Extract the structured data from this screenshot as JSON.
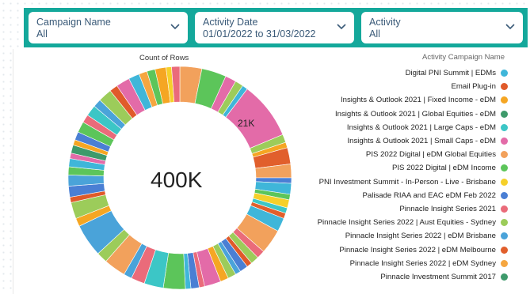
{
  "filters": [
    {
      "label": "Campaign Name",
      "value": "All"
    },
    {
      "label": "Activity Date",
      "value": "01/01/2022 to 31/03/2022"
    },
    {
      "label": "Activity",
      "value": "All"
    }
  ],
  "chart": {
    "title": "Count of Rows",
    "center_label": "400K",
    "slice_label": "21K"
  },
  "legend": {
    "title": "Activity Campaign Name",
    "items": [
      {
        "name": "Digital PNI Summit | EDMs",
        "color": "#3fb6d9"
      },
      {
        "name": "Email Plug-in",
        "color": "#e05a2a"
      },
      {
        "name": "Insights & Outlook 2021 | Fixed Income - eDM",
        "color": "#f5a623"
      },
      {
        "name": "Insights & Outlook 2021 | Global Equities - eDM",
        "color": "#3e9a6b"
      },
      {
        "name": "Insights & Outlook 2021 | Large Caps - eDM",
        "color": "#3cc6c6"
      },
      {
        "name": "Insights & Outlook 2021 | Small Caps - eDM",
        "color": "#e36ba8"
      },
      {
        "name": "PIS 2022 Digital | eDM Global Equities",
        "color": "#f2a15c"
      },
      {
        "name": "PIS 2022 Digital | eDM Income",
        "color": "#5cc55a"
      },
      {
        "name": "PNI Investment Summit - In-Person - Live - Brisbane",
        "color": "#f5d02a"
      },
      {
        "name": "Palisade RIAA and EAC eDM Feb 2022",
        "color": "#4a7fd4"
      },
      {
        "name": "Pinnacle Insight Series 2021",
        "color": "#ea6b7a"
      },
      {
        "name": "Pinnacle Insight Series 2022 | Aust Equities - Sydney",
        "color": "#9ccc5a"
      },
      {
        "name": "Pinnacle Insight Series 2022 | eDM Brisbane",
        "color": "#4aa3d9"
      },
      {
        "name": "Pinnacle Insight Series 2022 | eDM Melbourne",
        "color": "#e15f2c"
      },
      {
        "name": "Pinnacle Insight Series 2022 | eDM Sydney",
        "color": "#f5a640"
      },
      {
        "name": "Pinnacle Investment Summit 2017",
        "color": "#3e9a6b"
      }
    ]
  },
  "chart_data": {
    "type": "pie",
    "title": "Count of Rows",
    "total": 400000,
    "annotations": [
      "400K",
      "21K"
    ],
    "legend_title": "Activity Campaign Name",
    "legend_placement": "right",
    "series": [
      "Digital PNI Summit | EDMs",
      "Email Plug-in",
      "Insights & Outlook 2021 | Fixed Income - eDM",
      "Insights & Outlook 2021 | Global Equities - eDM",
      "Insights & Outlook 2021 | Large Caps - eDM",
      "Insights & Outlook 2021 | Small Caps - eDM",
      "PIS 2022 Digital | eDM Global Equities",
      "PIS 2022 Digital | eDM Income",
      "PNI Investment Summit - In-Person - Live - Brisbane",
      "Palisade RIAA and EAC eDM Feb 2022",
      "Pinnacle Insight Series 2021",
      "Pinnacle Insight Series 2022 | Aust Equities - Sydney",
      "Pinnacle Insight Series 2022 | eDM Brisbane",
      "Pinnacle Insight Series 2022 | eDM Melbourne",
      "Pinnacle Insight Series 2022 | eDM Sydney",
      "Pinnacle Investment Summit 2017"
    ],
    "slices": [
      {
        "ci": 6,
        "v": 8
      },
      {
        "ci": 7,
        "v": 9
      },
      {
        "ci": 5,
        "v": 4
      },
      {
        "ci": 11,
        "v": 3
      },
      {
        "ci": 0,
        "v": 2
      },
      {
        "ci": 5,
        "v": 21
      },
      {
        "ci": 11,
        "v": 3
      },
      {
        "ci": 2,
        "v": 2
      },
      {
        "ci": 13,
        "v": 6
      },
      {
        "ci": 6,
        "v": 5
      },
      {
        "ci": 9,
        "v": 2
      },
      {
        "ci": 0,
        "v": 4
      },
      {
        "ci": 7,
        "v": 2
      },
      {
        "ci": 8,
        "v": 3
      },
      {
        "ci": 4,
        "v": 2
      },
      {
        "ci": 13,
        "v": 2
      },
      {
        "ci": 0,
        "v": 5
      },
      {
        "ci": 6,
        "v": 9
      },
      {
        "ci": 10,
        "v": 3
      },
      {
        "ci": 11,
        "v": 3
      },
      {
        "ci": 1,
        "v": 2
      },
      {
        "ci": 9,
        "v": 3
      },
      {
        "ci": 12,
        "v": 2
      },
      {
        "ci": 11,
        "v": 3
      },
      {
        "ci": 2,
        "v": 3
      },
      {
        "ci": 5,
        "v": 6
      },
      {
        "ci": 10,
        "v": 2
      },
      {
        "ci": 9,
        "v": 3
      },
      {
        "ci": 0,
        "v": 2
      },
      {
        "ci": 7,
        "v": 8
      },
      {
        "ci": 4,
        "v": 7
      },
      {
        "ci": 10,
        "v": 5
      },
      {
        "ci": 12,
        "v": 3
      },
      {
        "ci": 6,
        "v": 8
      },
      {
        "ci": 11,
        "v": 4
      },
      {
        "ci": 12,
        "v": 12
      },
      {
        "ci": 2,
        "v": 3
      },
      {
        "ci": 11,
        "v": 6
      },
      {
        "ci": 1,
        "v": 2
      },
      {
        "ci": 9,
        "v": 4
      },
      {
        "ci": 12,
        "v": 4
      },
      {
        "ci": 7,
        "v": 3
      },
      {
        "ci": 0,
        "v": 3
      },
      {
        "ci": 5,
        "v": 2
      },
      {
        "ci": 3,
        "v": 3
      },
      {
        "ci": 2,
        "v": 2
      },
      {
        "ci": 9,
        "v": 3
      },
      {
        "ci": 7,
        "v": 4
      },
      {
        "ci": 10,
        "v": 3
      },
      {
        "ci": 4,
        "v": 4
      },
      {
        "ci": 12,
        "v": 3
      },
      {
        "ci": 11,
        "v": 5
      },
      {
        "ci": 1,
        "v": 3
      },
      {
        "ci": 5,
        "v": 5
      },
      {
        "ci": 0,
        "v": 4
      },
      {
        "ci": 14,
        "v": 3
      },
      {
        "ci": 7,
        "v": 3
      },
      {
        "ci": 2,
        "v": 4
      },
      {
        "ci": 8,
        "v": 2
      },
      {
        "ci": 10,
        "v": 3
      }
    ]
  }
}
